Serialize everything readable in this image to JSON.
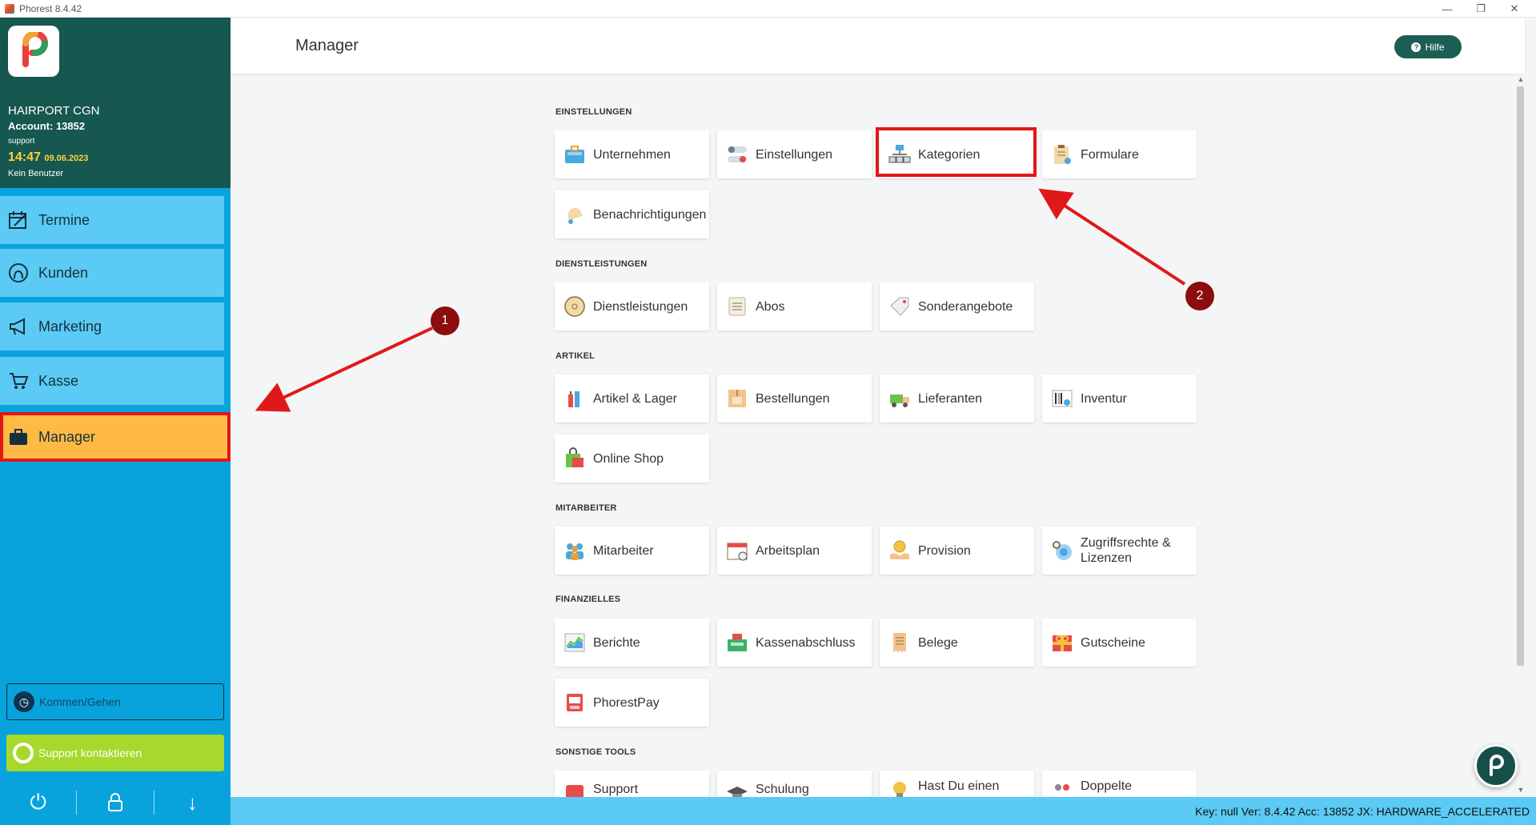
{
  "window": {
    "title": "Phorest 8.4.42"
  },
  "account": {
    "salon": "HAIRPORT CGN",
    "account": "Account: 13852",
    "user": "support",
    "time": "14:47",
    "date": "09.06.2023",
    "no_user": "Kein Benutzer"
  },
  "nav": [
    {
      "label": "Termine",
      "icon": "calendar-icon"
    },
    {
      "label": "Kunden",
      "icon": "client-icon"
    },
    {
      "label": "Marketing",
      "icon": "megaphone-icon"
    },
    {
      "label": "Kasse",
      "icon": "cart-icon"
    },
    {
      "label": "Manager",
      "icon": "briefcase-icon",
      "active": true
    }
  ],
  "sidebar_bottom": {
    "clock_label": "Kommen/Gehen",
    "support_label": "Support kontaktieren"
  },
  "header": {
    "title": "Manager",
    "help_label": "Hilfe"
  },
  "sections": [
    {
      "label": "EINSTELLUNGEN",
      "tiles": [
        "Unternehmen",
        "Einstellungen",
        "Kategorien",
        "Formulare",
        "Benachrichtigungen"
      ]
    },
    {
      "label": "DIENSTLEISTUNGEN",
      "tiles": [
        "Dienstleistungen",
        "Abos",
        "Sonderangebote"
      ]
    },
    {
      "label": "ARTIKEL",
      "tiles": [
        "Artikel & Lager",
        "Bestellungen",
        "Lieferanten",
        "Inventur",
        "Online Shop"
      ]
    },
    {
      "label": "MITARBEITER",
      "tiles": [
        "Mitarbeiter",
        "Arbeitsplan",
        "Provision",
        "Zugriffsrechte & Lizenzen"
      ]
    },
    {
      "label": "FINANZIELLES",
      "tiles": [
        "Berichte",
        "Kassenabschluss",
        "Belege",
        "Gutscheine",
        "PhorestPay"
      ]
    },
    {
      "label": "SONSTIGE TOOLS",
      "tiles": [
        "Support",
        "Schulung",
        "Hast Du einen",
        "Doppelte"
      ]
    }
  ],
  "status": {
    "text": "Key: null Ver: 8.4.42 Acc: 13852  JX: HARDWARE_ACCELERATED"
  },
  "annotations": {
    "badge1": "1",
    "badge2": "2"
  },
  "colors": {
    "sidebar": "#08a3dd",
    "account_bg": "#16574f",
    "nav_button": "#5bcaf5",
    "active_nav": "#ffba45",
    "highlight": "#e11818",
    "badge": "#8b0d0d",
    "support": "#a6d92b"
  }
}
